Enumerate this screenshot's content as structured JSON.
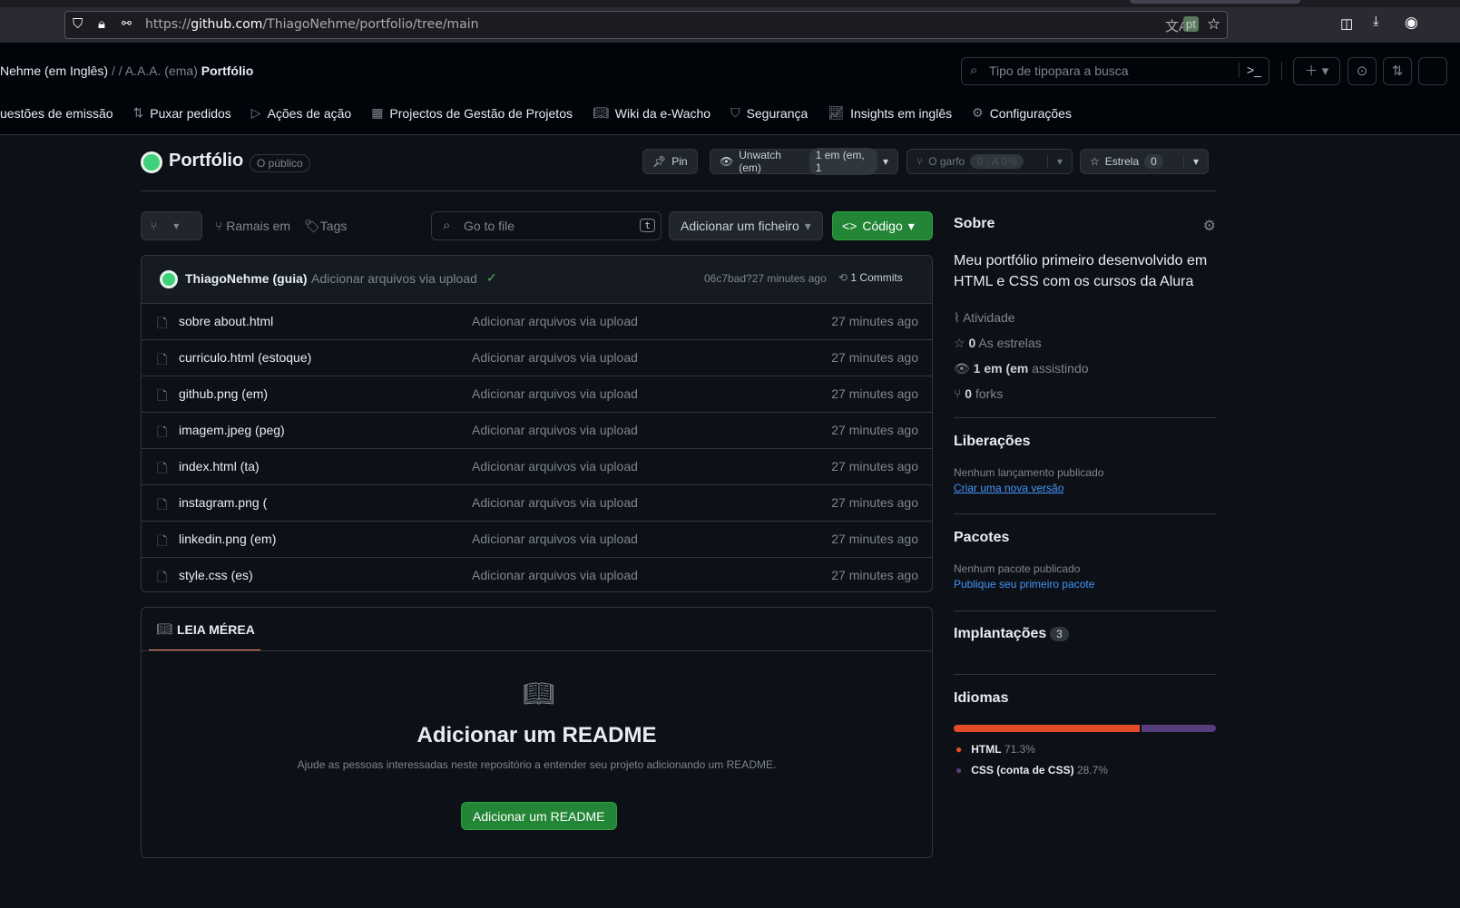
{
  "browser": {
    "url_prefix": "https://",
    "url_domain": "github.com",
    "url_path": "/ThiagoNehme/portfolio/tree/main",
    "translate_lang": "pt"
  },
  "header": {
    "breadcrumb_owner": "Nehme (em Inglês)",
    "breadcrumb_sep": "/ / A.A.A. (ema)",
    "breadcrumb_repo": "Portfólio",
    "search_placeholder": "Tipo de tipopara a busca"
  },
  "nav": [
    {
      "label": "uestões de emissão",
      "icon": "issue-icon"
    },
    {
      "label": "Puxar pedidos",
      "icon": "pull-request-icon"
    },
    {
      "label": "Ações de ação",
      "icon": "play-icon"
    },
    {
      "label": "Projectos de Gestão de Projetos",
      "icon": "table-icon"
    },
    {
      "label": "Wiki da e-Wacho",
      "icon": "book-icon"
    },
    {
      "label": "Segurança",
      "icon": "shield-icon"
    },
    {
      "label": "Insights em inglês",
      "icon": "graph-icon"
    },
    {
      "label": "Configurações",
      "icon": "gear-icon"
    }
  ],
  "repo": {
    "name": "Portfólio",
    "visibility": "O público",
    "pin": "Pin",
    "unwatch": "Unwatch (em)",
    "watch_count": "1 em (em, 1",
    "fork": "O garfo",
    "fork_count": "0 - A 0%",
    "star": "Estrela",
    "star_count": "0"
  },
  "toolbar": {
    "branches": "Ramais em",
    "tags": "Tags",
    "goto_placeholder": "Go to file",
    "goto_key": "t",
    "add_file": "Adicionar um ficheiro",
    "code": "Código"
  },
  "commit": {
    "author": "ThiagoNehme (guia)",
    "message": "Adicionar arquivos via upload",
    "hash_time": "06c7bad?27 minutes ago",
    "commits": "1 Commits"
  },
  "files": [
    {
      "name": "sobre about.html",
      "msg": "Adicionar arquivos via upload",
      "time": "27 minutes ago"
    },
    {
      "name": "curriculo.html (estoque)",
      "msg": "Adicionar arquivos via upload",
      "time": "27 minutes ago"
    },
    {
      "name": "github.png (em)",
      "msg": "Adicionar arquivos via upload",
      "time": "27 minutes ago"
    },
    {
      "name": "imagem.jpeg (peg)",
      "msg": "Adicionar arquivos via upload",
      "time": "27 minutes ago"
    },
    {
      "name": "index.html (ta)",
      "msg": "Adicionar arquivos via upload",
      "time": "27 minutes ago"
    },
    {
      "name": "instagram.png (",
      "msg": "Adicionar arquivos via upload",
      "time": "27 minutes ago"
    },
    {
      "name": "linkedin.png (em)",
      "msg": "Adicionar arquivos via upload",
      "time": "27 minutes ago"
    },
    {
      "name": "style.css (es)",
      "msg": "Adicionar arquivos via upload",
      "time": "27 minutes ago"
    }
  ],
  "readme": {
    "tab": "LEIA MÉREA",
    "title": "Adicionar um README",
    "desc": "Ajude as pessoas interessadas neste repositório a entender seu projeto adicionando um README.",
    "button": "Adicionar um README"
  },
  "about": {
    "title": "Sobre",
    "desc": "Meu portfólio primeiro desenvolvido em HTML e CSS com os cursos da Alura",
    "activity": "Atividade",
    "stars_n": "0",
    "stars": "As estrelas",
    "watch_n": "1 em (em",
    "watch": "assistindo",
    "forks_n": "0",
    "forks": "forks"
  },
  "releases": {
    "title": "Liberações",
    "none": "Nenhum lançamento publicado",
    "link": "Criar uma nova versão"
  },
  "packages": {
    "title": "Pacotes",
    "none": "Nenhum pacote publicado",
    "link": "Publique seu primeiro pacote"
  },
  "deployments": {
    "title": "Implantações",
    "count": "3"
  },
  "languages": {
    "title": "Idiomas",
    "items": [
      {
        "name": "HTML",
        "pct": "71.3%",
        "value": 71.3,
        "color": "#e34c26"
      },
      {
        "name": "CSS (conta de CSS)",
        "pct": "28.7%",
        "value": 28.7,
        "color": "#563d7c"
      }
    ]
  }
}
